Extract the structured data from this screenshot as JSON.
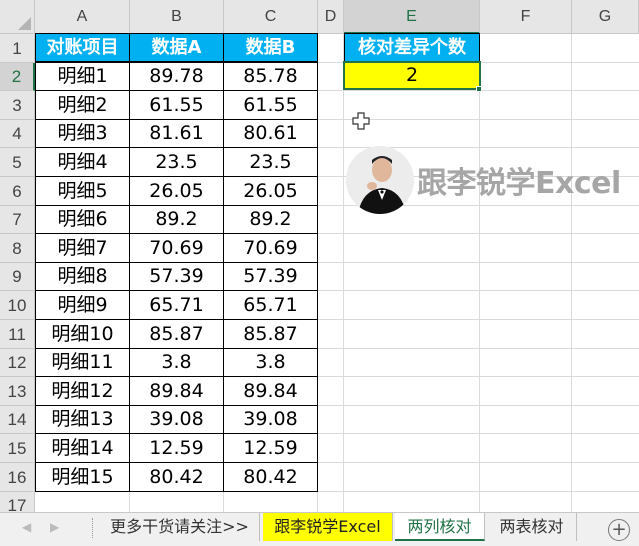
{
  "columns": [
    "A",
    "B",
    "C",
    "D",
    "E",
    "F",
    "G"
  ],
  "rows": [
    "1",
    "2",
    "3",
    "4",
    "5",
    "6",
    "7",
    "8",
    "9",
    "10",
    "11",
    "12",
    "13",
    "14",
    "15",
    "16",
    "17"
  ],
  "table_header": {
    "item": "对账项目",
    "a": "数据A",
    "b": "数据B"
  },
  "table_rows": [
    {
      "item": "明细1",
      "a": "89.78",
      "b": "85.78"
    },
    {
      "item": "明细2",
      "a": "61.55",
      "b": "61.55"
    },
    {
      "item": "明细3",
      "a": "81.61",
      "b": "80.61"
    },
    {
      "item": "明细4",
      "a": "23.5",
      "b": "23.5"
    },
    {
      "item": "明细5",
      "a": "26.05",
      "b": "26.05"
    },
    {
      "item": "明细6",
      "a": "89.2",
      "b": "89.2"
    },
    {
      "item": "明细7",
      "a": "70.69",
      "b": "70.69"
    },
    {
      "item": "明细8",
      "a": "57.39",
      "b": "57.39"
    },
    {
      "item": "明细9",
      "a": "65.71",
      "b": "65.71"
    },
    {
      "item": "明细10",
      "a": "85.87",
      "b": "85.87"
    },
    {
      "item": "明细11",
      "a": "3.8",
      "b": "3.8"
    },
    {
      "item": "明细12",
      "a": "89.84",
      "b": "89.84"
    },
    {
      "item": "明细13",
      "a": "39.08",
      "b": "39.08"
    },
    {
      "item": "明细14",
      "a": "12.59",
      "b": "12.59"
    },
    {
      "item": "明细15",
      "a": "80.42",
      "b": "80.42"
    }
  ],
  "summary": {
    "label": "核对差异个数",
    "value": "2"
  },
  "watermark": {
    "text": "跟李锐学Excel"
  },
  "sheet_tabs": [
    {
      "label": "更多干货请关注>>",
      "state": "normal"
    },
    {
      "label": "跟李锐学Excel",
      "state": "highlight"
    },
    {
      "label": "两列核对",
      "state": "active"
    },
    {
      "label": "两表核对",
      "state": "normal"
    }
  ],
  "icons": {
    "add_sheet": "plus-circle-icon",
    "cursor": "cell-cursor-icon",
    "nav_prev": "triangle-left-icon",
    "nav_next": "triangle-right-icon"
  },
  "colors": {
    "header_blue": "#00b0f0",
    "highlight_yellow": "#ffff00",
    "excel_green": "#217346"
  }
}
